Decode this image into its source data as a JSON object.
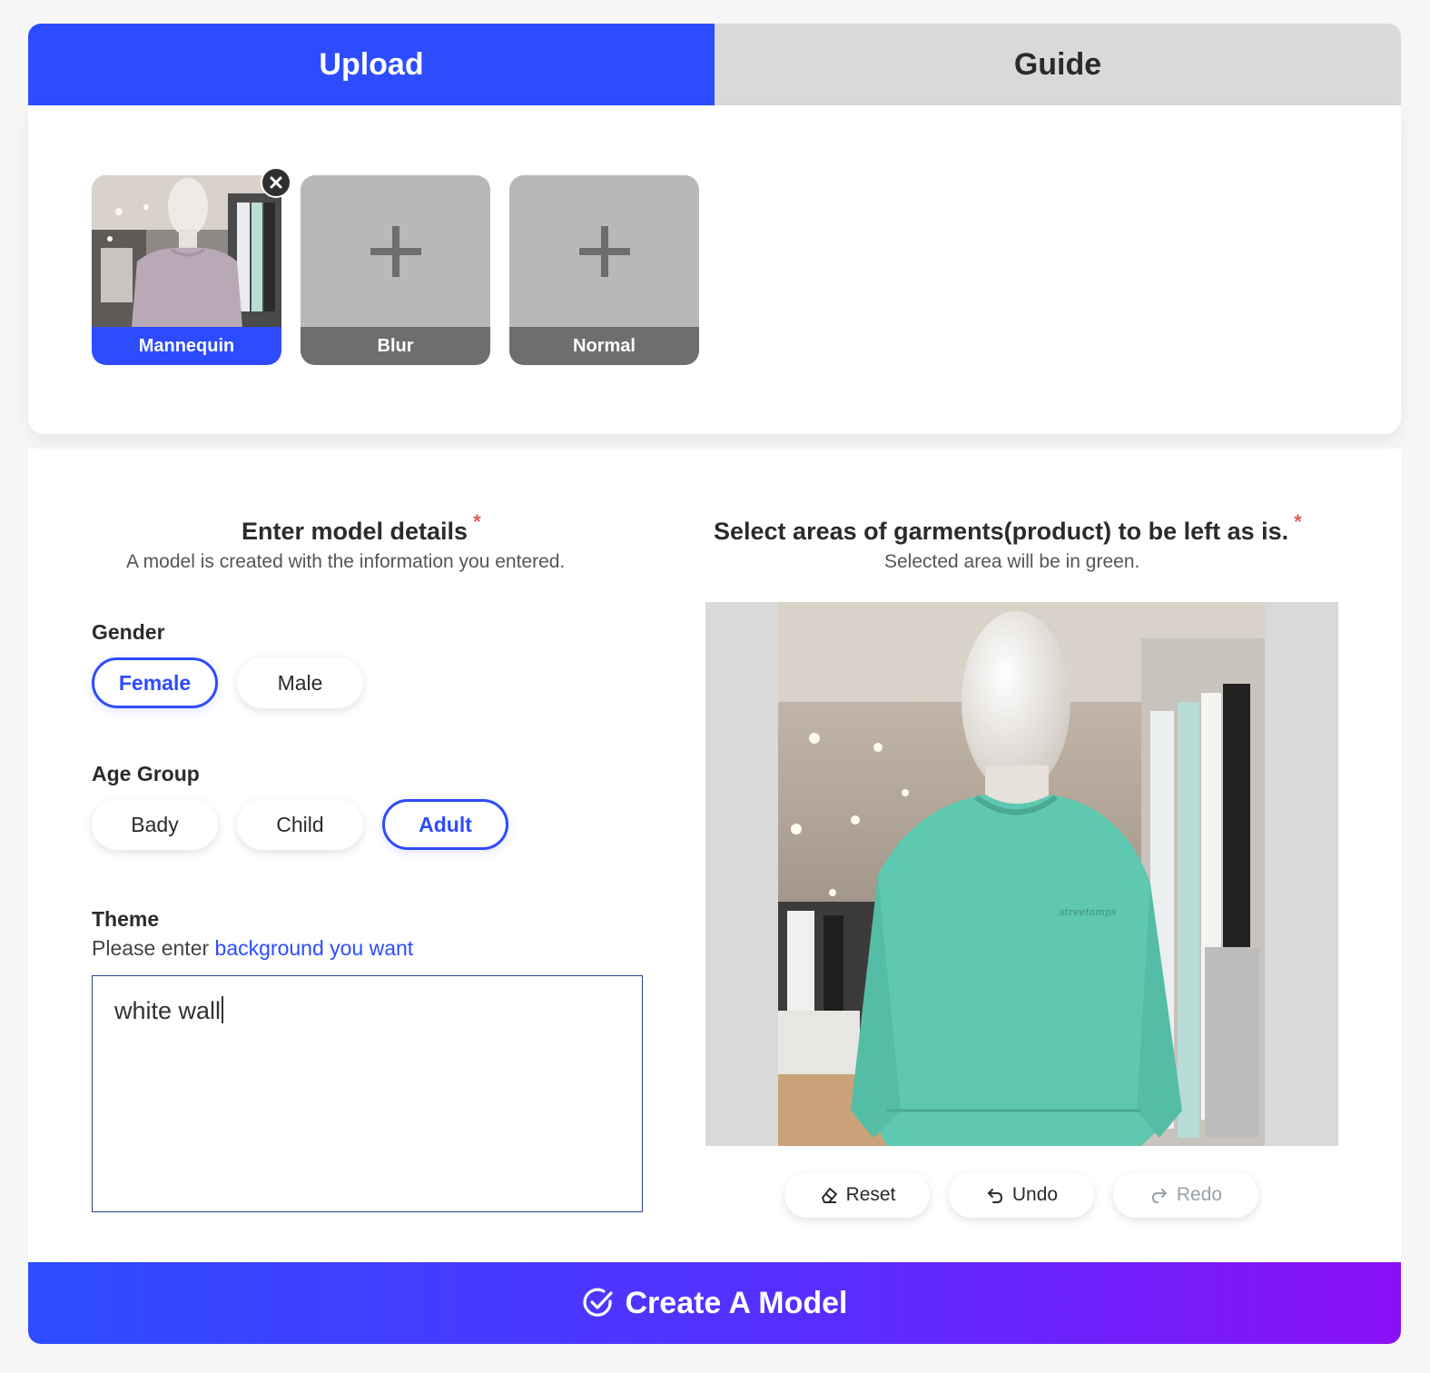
{
  "tabs": [
    {
      "label": "Upload",
      "active": true
    },
    {
      "label": "Guide",
      "active": false
    }
  ],
  "upload": {
    "slots": [
      {
        "label": "Mannequin",
        "has_image": true
      },
      {
        "label": "Blur",
        "has_image": false
      },
      {
        "label": "Normal",
        "has_image": false
      }
    ]
  },
  "model_details": {
    "title": "Enter model details",
    "required_mark": "*",
    "subtitle": "A model is created with the information you entered.",
    "gender": {
      "label": "Gender",
      "options": [
        "Female",
        "Male"
      ],
      "selected": "Female"
    },
    "age_group": {
      "label": "Age Group",
      "options": [
        "Bady",
        "Child",
        "Adult"
      ],
      "selected": "Adult"
    },
    "theme": {
      "label": "Theme",
      "hint_prefix": "Please enter ",
      "hint_link": "background you want",
      "value": "white wall"
    }
  },
  "garment_select": {
    "title": "Select areas of garments(product) to be left as is.",
    "required_mark": "*",
    "subtitle": "Selected area will be in green.",
    "tools": {
      "reset": "Reset",
      "undo": "Undo",
      "redo": "Redo"
    }
  },
  "create_button": {
    "label": "Create A Model"
  },
  "colors": {
    "accent": "#2d4cff",
    "gradient_end": "#8a10f5",
    "selection_green": "#5ec8b0",
    "required": "#e25b5b"
  },
  "icons": {
    "close": "close-icon",
    "add": "plus-icon",
    "reset": "eraser-icon",
    "undo": "undo-icon",
    "redo": "redo-icon",
    "create": "check-circle-icon"
  }
}
